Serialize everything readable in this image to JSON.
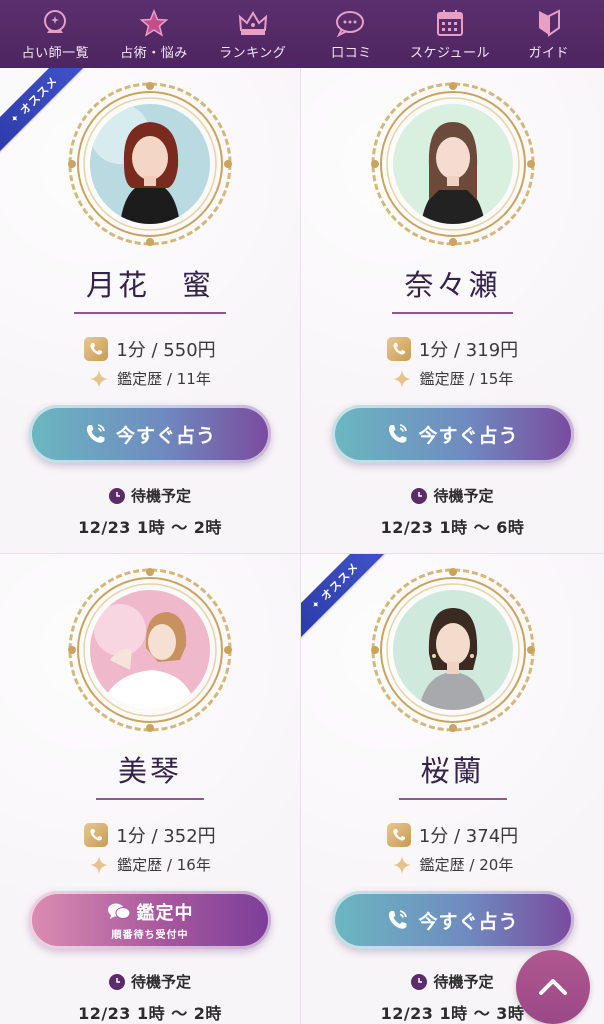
{
  "nav": {
    "items": [
      {
        "label": "占い師一覧",
        "icon": "crystal-ball-icon"
      },
      {
        "label": "占術・悩み",
        "icon": "star-icon"
      },
      {
        "label": "ランキング",
        "icon": "crown-icon"
      },
      {
        "label": "口コミ",
        "icon": "speech-bubble-icon"
      },
      {
        "label": "スケジュール",
        "icon": "calendar-icon"
      },
      {
        "label": "ガイド",
        "icon": "beginner-mark-icon"
      }
    ]
  },
  "ribbon_text": "オススメ",
  "cards": [
    {
      "name": "月花　蜜",
      "price": "1分 / 550円",
      "experience": "鑑定歴 / 11年",
      "button_label": "今すぐ占う",
      "status": "available",
      "recommended": true,
      "standby_label": "待機予定",
      "schedule": "12/23  1時 〜 2時"
    },
    {
      "name": "奈々瀬",
      "price": "1分 / 319円",
      "experience": "鑑定歴 / 15年",
      "button_label": "今すぐ占う",
      "status": "available",
      "recommended": false,
      "standby_label": "待機予定",
      "schedule": "12/23  1時 〜 6時"
    },
    {
      "name": "美琴",
      "price": "1分 / 352円",
      "experience": "鑑定歴 / 16年",
      "button_label": "鑑定中",
      "button_sub": "順番待ち受付中",
      "status": "busy",
      "recommended": false,
      "standby_label": "待機予定",
      "schedule": "12/23  1時 〜 2時"
    },
    {
      "name": "桜蘭",
      "price": "1分 / 374円",
      "experience": "鑑定歴 / 20年",
      "button_label": "今すぐ占う",
      "status": "available",
      "recommended": true,
      "standby_label": "待機予定",
      "schedule": "12/23  1時 〜 3時"
    }
  ],
  "colors": {
    "nav_bg": "#52296a",
    "ribbon": "#3446b8",
    "call_button": "#6f8bbf",
    "busy_button": "#a8589c",
    "back_to_top": "#a5508c"
  }
}
